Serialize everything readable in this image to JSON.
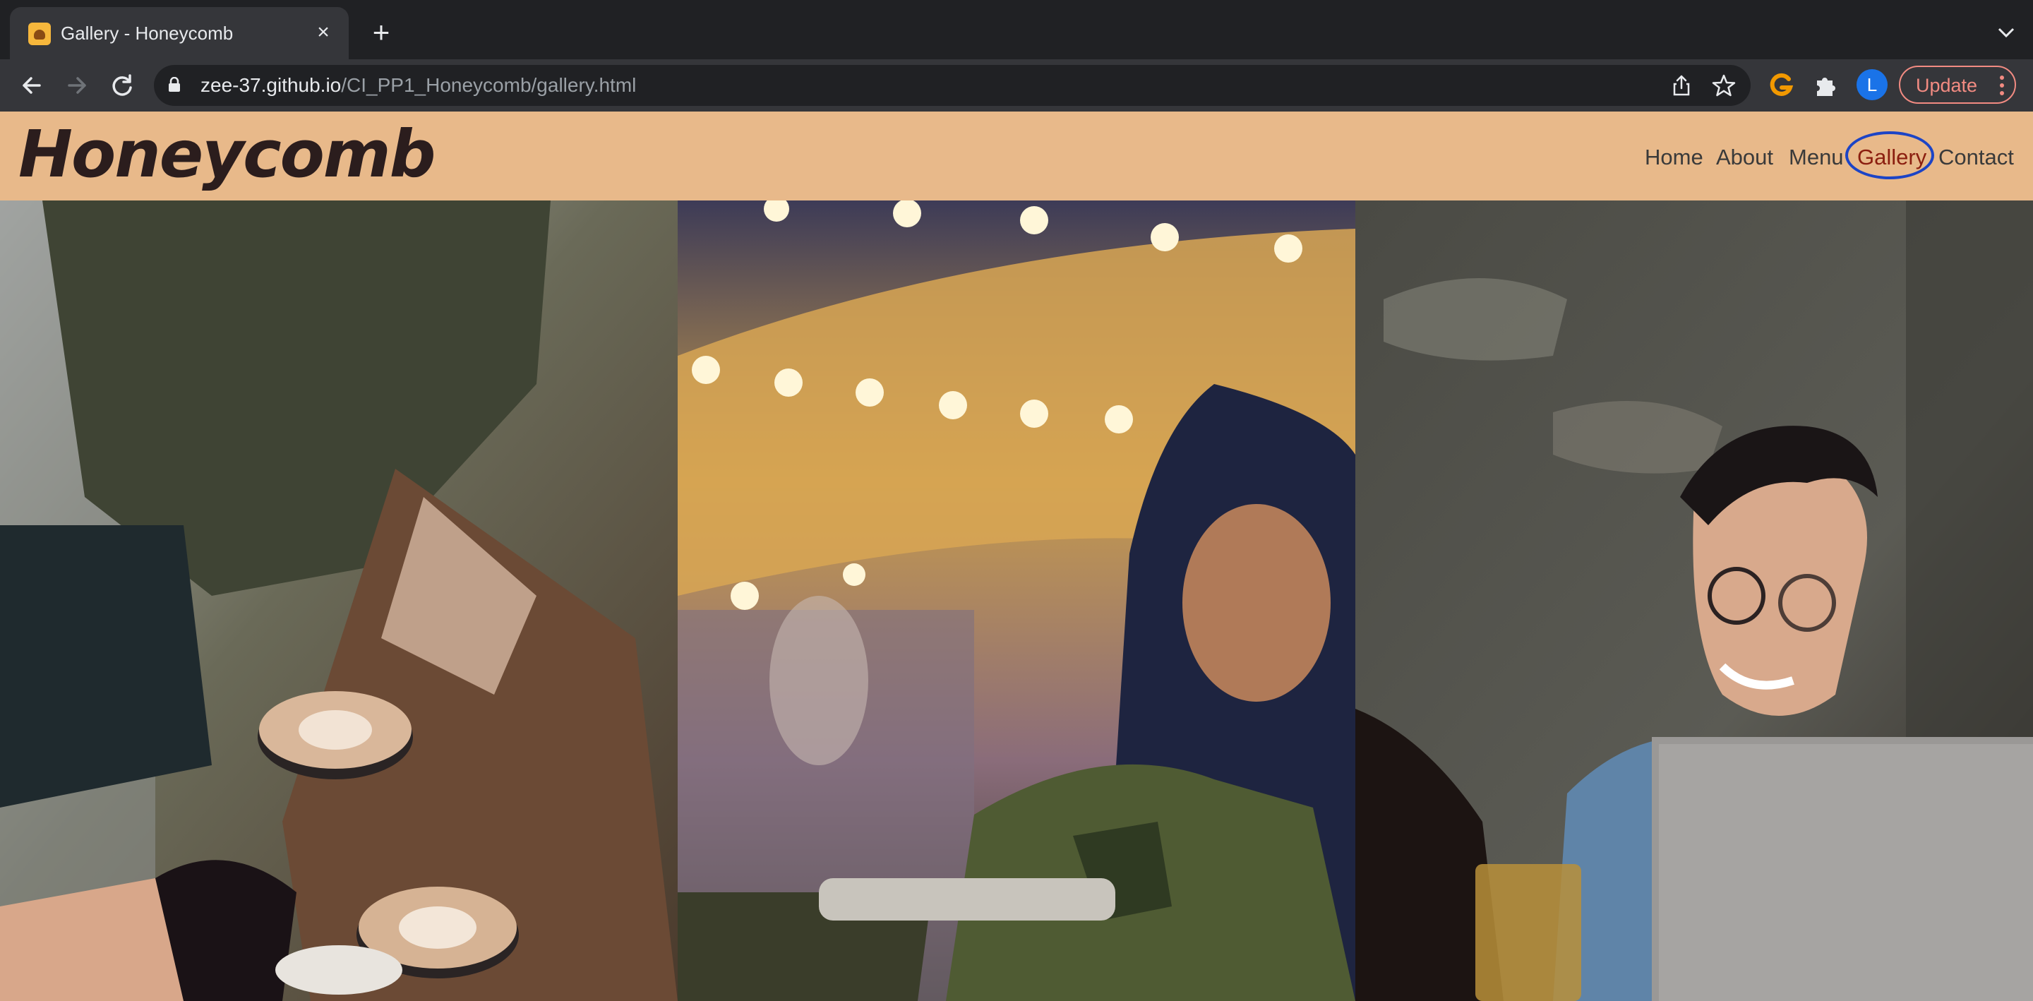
{
  "browser": {
    "tab_title": "Gallery - Honeycomb",
    "url_host": "zee-37.github.io",
    "url_path": "/CI_PP1_Honeycomb/gallery.html",
    "profile_initial": "L",
    "update_label": "Update"
  },
  "site": {
    "logo": "Honeycomb",
    "nav": [
      {
        "label": "Home"
      },
      {
        "label": "About"
      },
      {
        "label": "Menu"
      },
      {
        "label": "Gallery",
        "active": true
      },
      {
        "label": "Contact"
      }
    ],
    "colors": {
      "header_bg": "#e8b98a",
      "logo": "#2b1d1d",
      "active_link": "#8b1e0f",
      "annotation_ring": "#1c44c6"
    }
  },
  "gallery": {
    "images": [
      {
        "subject": "coffee-toast-photo"
      },
      {
        "subject": "bartender-photo"
      },
      {
        "subject": "laughing-person-photo"
      }
    ]
  }
}
